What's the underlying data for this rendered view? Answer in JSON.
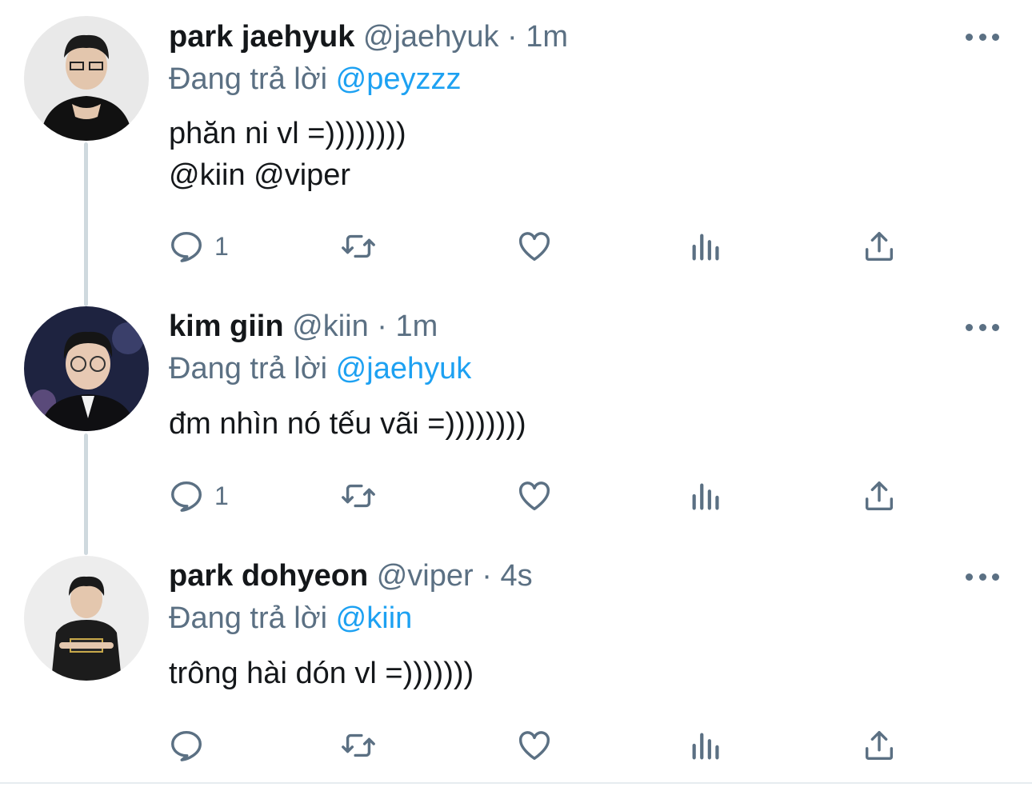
{
  "tweets": [
    {
      "name": "park jaehyuk",
      "handle": "@jaehyuk",
      "separator": "·",
      "time": "1m",
      "reply_prefix": "Đang trả lời",
      "reply_to": "@peyzzz",
      "text": "phăn ni vl =))))))))",
      "mentions": "@kiin @viper",
      "reply_count": "1"
    },
    {
      "name": "kim giin",
      "handle": "@kiin",
      "separator": "·",
      "time": "1m",
      "reply_prefix": "Đang trả lời",
      "reply_to": "@jaehyuk",
      "text": "đm nhìn nó tếu vãi =))))))))",
      "reply_count": "1"
    },
    {
      "name": "park dohyeon",
      "handle": "@viper",
      "separator": "·",
      "time": "4s",
      "reply_prefix": "Đang trả lời",
      "reply_to": "@kiin",
      "text": "trông hài dón vl =)))))))",
      "reply_count": ""
    }
  ],
  "colors": {
    "link": "#1da1f2",
    "secondary": "#5b7083",
    "thread_line": "#cfd9de"
  },
  "icons": [
    "reply-icon",
    "retweet-icon",
    "like-icon",
    "analytics-icon",
    "share-icon",
    "more-icon"
  ]
}
